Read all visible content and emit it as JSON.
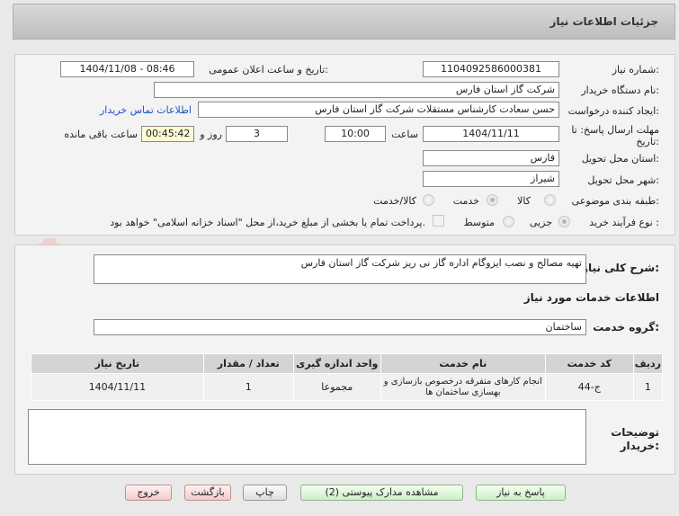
{
  "header": {
    "title": "جزئیات اطلاعات نیاز"
  },
  "form": {
    "need_number_label": "شماره نیاز:",
    "need_number": "1104092586000381",
    "announce_label": "تاریخ و ساعت اعلان عمومی:",
    "announce_value": "1404/11/08 - 08:46",
    "buyer_label": "نام دستگاه خریدار:",
    "buyer_value": "شرکت گاز استان فارس",
    "creator_label": "ایجاد کننده درخواست:",
    "creator_value": "حسن سعادت کارشناس مستقلات شرکت گاز استان فارس",
    "contact_link": "اطلاعات تماس خریدار",
    "deadline_label_1": "مهلت ارسال پاسخ: تا",
    "deadline_label_2": "تاریخ:",
    "deadline_date": "1404/11/11",
    "time_label": "ساعت",
    "deadline_time": "10:00",
    "days_value": "3",
    "days_label": "روز و",
    "remaining_time": "00:45:42",
    "remaining_label": "ساعت باقی مانده",
    "province_label": "استان محل تحویل:",
    "province_value": "فارس",
    "city_label": "شهر محل تحویل:",
    "city_value": "شیراز",
    "category_label": "طبقه بندی موضوعی:",
    "category_options": [
      "کالا",
      "خدمت",
      "کالا/خدمت"
    ],
    "purchase_label": "نوع فرآیند خرید :",
    "purchase_options": [
      "جزیی",
      "متوسط"
    ],
    "payment_note": "پرداخت تمام یا بخشی از مبلغ خرید،از محل \"اسناد خزانه اسلامی\" خواهد بود."
  },
  "description": {
    "label": "شرح کلی نیاز:",
    "value": "تهیه مصالح و نصب ایزوگام اداره گاز نی ریز شرکت گاز استان فارس"
  },
  "services": {
    "section_title": "اطلاعات خدمات مورد نیاز",
    "group_label": "گروه خدمت:",
    "group_value": "ساختمان",
    "columns": [
      "ردیف",
      "کد خدمت",
      "نام خدمت",
      "واحد اندازه گیری",
      "تعداد / مقدار",
      "تاریخ نیاز"
    ],
    "rows": [
      {
        "index": "1",
        "code": "ج-44",
        "name": "انجام کارهای متفرقه درخصوص بازسازی و بهسازی ساختمان ها",
        "unit": "مجموعا",
        "qty": "1",
        "date": "1404/11/11"
      }
    ]
  },
  "notes": {
    "label_1": "توضیحات",
    "label_2": "خریدار:",
    "value": ""
  },
  "buttons": {
    "reply": "پاسخ به نیاز",
    "docs": "مشاهده مدارک پیوستی (2)",
    "print": "چاپ",
    "back": "بازگشت",
    "exit": "خروج"
  },
  "watermark": {
    "text": "AriaTender.net"
  },
  "colors": {
    "link": "#1d55c4",
    "watermark": "#f1d0d0"
  }
}
